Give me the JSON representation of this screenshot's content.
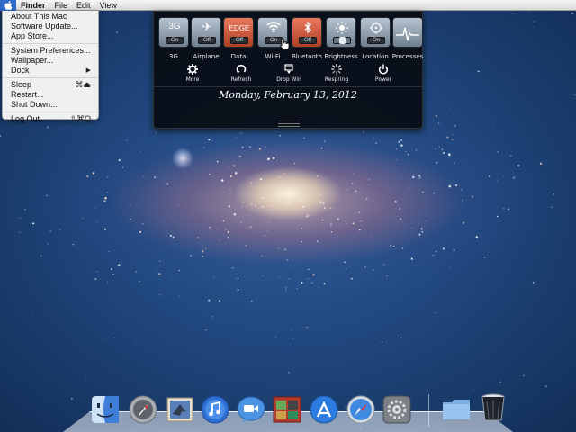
{
  "menubar": {
    "app_name": "Finder",
    "items": [
      "File",
      "Edit",
      "View"
    ]
  },
  "apple_menu": {
    "items": [
      {
        "label": "About This Mac",
        "shortcut": ""
      },
      {
        "label": "Software Update...",
        "shortcut": ""
      },
      {
        "label": "App Store...",
        "shortcut": ""
      },
      {
        "label": "System Preferences...",
        "shortcut": ""
      },
      {
        "label": "Wallpaper...",
        "shortcut": ""
      },
      {
        "label": "Dock",
        "shortcut": "▶"
      },
      {
        "label": "Sleep",
        "shortcut": "⌘⏏"
      },
      {
        "label": "Restart...",
        "shortcut": ""
      },
      {
        "label": "Shut Down...",
        "shortcut": ""
      },
      {
        "label": "Log Out",
        "shortcut": "⇧⌘Q"
      }
    ]
  },
  "panel": {
    "toggles": [
      {
        "label": "3G",
        "glyph": "3G",
        "state": "On",
        "icon": "3g-icon",
        "style": "blue"
      },
      {
        "label": "Airplane",
        "glyph": "✈",
        "state": "Off",
        "icon": "airplane-icon",
        "style": "blue"
      },
      {
        "label": "Data",
        "glyph": "EDGE",
        "state": "Off",
        "icon": "edge-icon",
        "style": "red"
      },
      {
        "label": "Wi-Fi",
        "glyph": "",
        "state": "On",
        "icon": "wifi-icon",
        "style": "blue"
      },
      {
        "label": "Bluetooth",
        "glyph": "",
        "state": "Off",
        "icon": "bluetooth-icon",
        "style": "red"
      },
      {
        "label": "Brightness",
        "glyph": "",
        "state": "",
        "icon": "brightness-icon",
        "style": "blue"
      },
      {
        "label": "Location",
        "glyph": "",
        "state": "On",
        "icon": "location-icon",
        "style": "blue"
      },
      {
        "label": "Processes",
        "glyph": "",
        "state": "",
        "icon": "processes-icon",
        "style": "blue"
      }
    ],
    "actions": [
      {
        "label": "More",
        "icon": "gear-icon"
      },
      {
        "label": "Refresh",
        "icon": "refresh-icon"
      },
      {
        "label": "Drop Win",
        "icon": "drop-window-icon"
      },
      {
        "label": "Respring",
        "icon": "respring-icon"
      },
      {
        "label": "Power",
        "icon": "power-icon"
      }
    ],
    "date": "Monday, February 13, 2012"
  },
  "dock": {
    "items": [
      {
        "name": "finder-icon",
        "color": "#4f8fe0"
      },
      {
        "name": "launchpad-icon",
        "color": "#9aa0a8"
      },
      {
        "name": "mail-icon",
        "color": "#d8d2c0"
      },
      {
        "name": "itunes-icon",
        "color": "#3b78d8"
      },
      {
        "name": "facetime-icon",
        "color": "#5ea2e8"
      },
      {
        "name": "photo-booth-icon",
        "color": "#b93a2f"
      },
      {
        "name": "app-store-icon",
        "color": "#2d7be0"
      },
      {
        "name": "safari-icon",
        "color": "#3a85d6"
      },
      {
        "name": "system-preferences-icon",
        "color": "#8a8d92"
      },
      {
        "name": "documents-folder-icon",
        "color": "#8fb8e6"
      },
      {
        "name": "trash-icon",
        "color": "#c8ccd2"
      }
    ]
  }
}
